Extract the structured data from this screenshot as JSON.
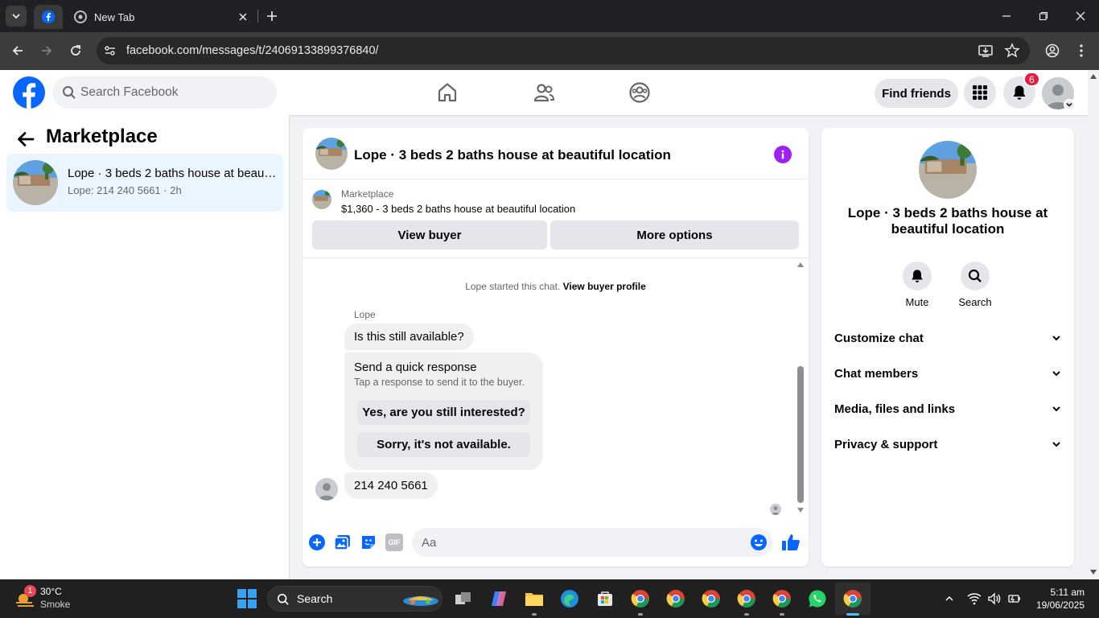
{
  "browser": {
    "tab_title": "New Tab",
    "url": "facebook.com/messages/t/24069133899376840/"
  },
  "fb": {
    "search_placeholder": "Search Facebook",
    "find_friends": "Find friends",
    "notifications_count": "6"
  },
  "left_panel": {
    "title": "Marketplace",
    "conversations": [
      {
        "name": "Lope · 3 beds 2 baths house at beautiful location",
        "preview": "Lope: 214 240 5661 · 2h"
      }
    ]
  },
  "chat": {
    "title": "Lope · 3 beds 2 baths house at beautiful location",
    "marketplace_label": "Marketplace",
    "listing": "$1,360 - 3 beds 2 baths house at beautiful location",
    "view_buyer": "View buyer",
    "more_options": "More options",
    "system_text": "Lope started this chat.",
    "system_link": "View buyer profile",
    "sender": "Lope",
    "message_1": "Is this still available?",
    "quick_response_title": "Send a quick response",
    "quick_response_sub": "Tap a response to send it to the buyer.",
    "quick_reply_1": "Yes, are you still interested?",
    "quick_reply_2": "Sorry, it's not available.",
    "message_2": "214 240 5661",
    "composer_placeholder": "Aa",
    "gif_label": "GIF"
  },
  "right_panel": {
    "title": "Lope · 3 beds 2 baths house at beautiful location",
    "mute": "Mute",
    "search": "Search",
    "sections": [
      "Customize chat",
      "Chat members",
      "Media, files and links",
      "Privacy & support"
    ]
  },
  "taskbar": {
    "weather_temp": "30°C",
    "weather_cond": "Smoke",
    "weather_badge": "1",
    "search": "Search",
    "time": "5:11 am",
    "date": "19/06/2025"
  },
  "colors": {
    "fb_blue": "#0866ff",
    "selected_bg": "#ebf5ff",
    "notif_red": "#e41e3f",
    "info_purple": "#a020f0"
  }
}
